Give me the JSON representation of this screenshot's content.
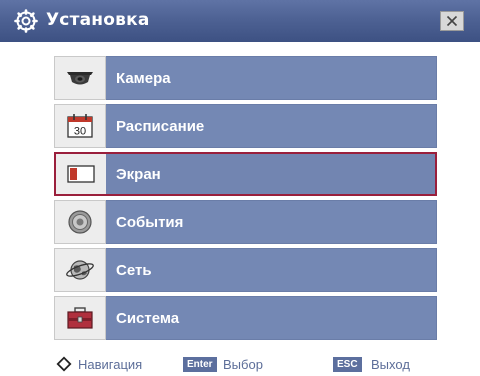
{
  "window": {
    "title": "Установка",
    "title_icon": "gear-icon",
    "close_icon": "close-icon"
  },
  "menu": {
    "selected_index": 2,
    "items": [
      {
        "label": "Камера",
        "icon": "camera-icon"
      },
      {
        "label": "Расписание",
        "icon": "calendar-icon",
        "icon_text": "30"
      },
      {
        "label": "Экран",
        "icon": "display-icon"
      },
      {
        "label": "События",
        "icon": "events-icon"
      },
      {
        "label": "Сеть",
        "icon": "network-icon"
      },
      {
        "label": "Система",
        "icon": "system-icon"
      }
    ]
  },
  "footer": {
    "nav_label": "Навигация",
    "enter_key": "Enter",
    "enter_label": "Выбор",
    "esc_key": "ESC",
    "esc_label": "Выход"
  },
  "colors": {
    "titlebar": "#4e6294",
    "menu_label_bg": "#7488b4",
    "selection_border": "#9a1f3c",
    "footer_text": "#5d6e99"
  }
}
